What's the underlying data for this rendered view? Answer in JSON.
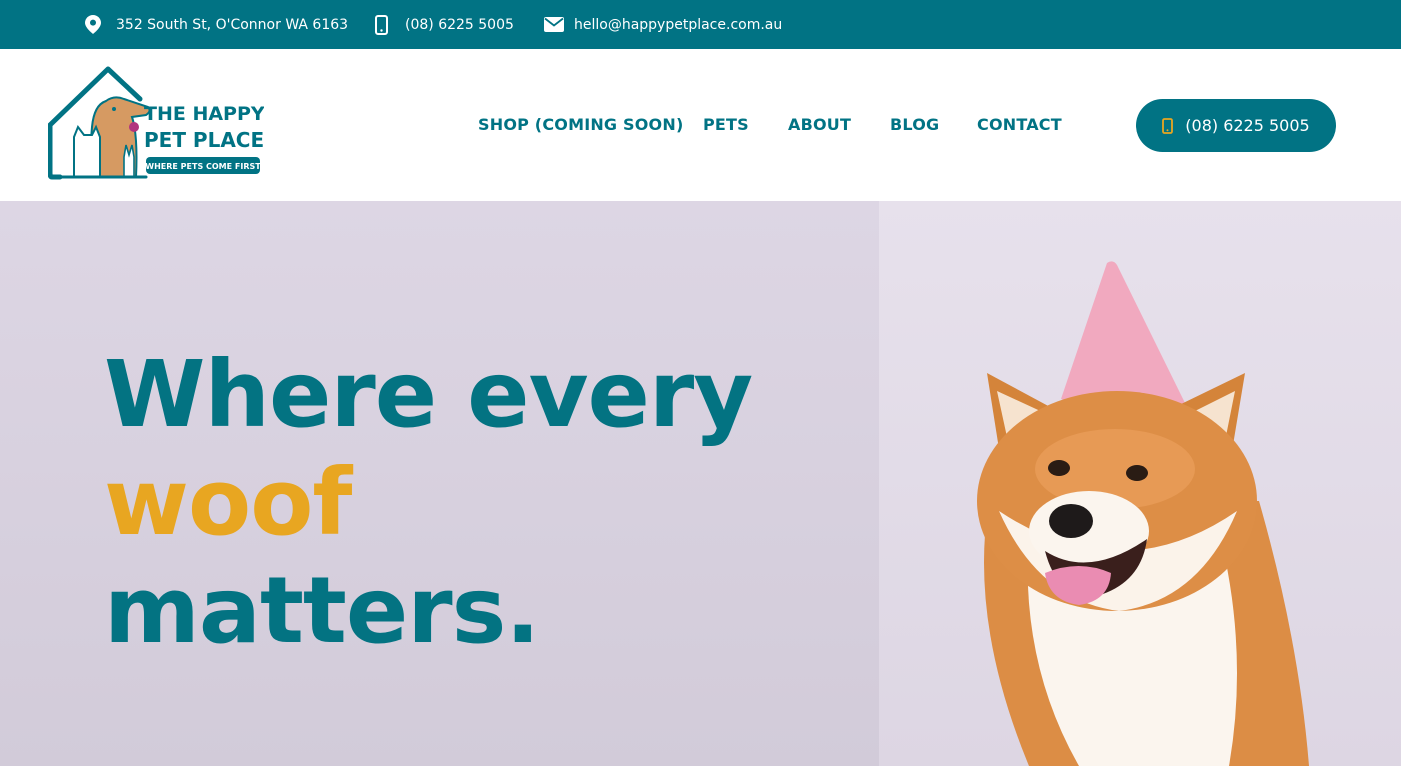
{
  "topbar": {
    "address": "352 South St, O'Connor WA 6163",
    "phone": "(08) 6225 5005",
    "email": "hello@happypetplace.com.au",
    "icons": [
      "location-pin-icon",
      "mobile-phone-icon",
      "envelope-icon"
    ]
  },
  "logo": {
    "line1": "THE HAPPY",
    "line2": "PET PLACE",
    "tagline": "WHERE PETS COME FIRST"
  },
  "nav": {
    "items": [
      {
        "label": "SHOP (COMING SOON)"
      },
      {
        "label": "PETS"
      },
      {
        "label": "ABOUT"
      },
      {
        "label": "BLOG"
      },
      {
        "label": "CONTACT"
      }
    ]
  },
  "cta": {
    "phone_label": "(08) 6225 5005"
  },
  "hero": {
    "line1": "Where every",
    "line2": "woof",
    "line3": "matters."
  },
  "colors": {
    "primary": "#017384",
    "accent": "#e8a621",
    "hero_bg": "#d9d2e0",
    "white": "#ffffff"
  }
}
